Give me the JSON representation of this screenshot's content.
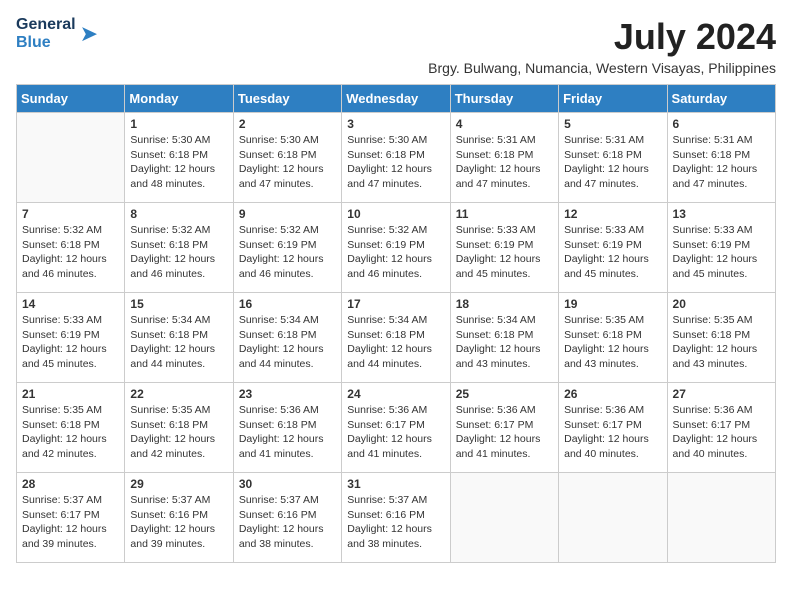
{
  "header": {
    "logo_line1": "General",
    "logo_line2": "Blue",
    "month_year": "July 2024",
    "location": "Brgy. Bulwang, Numancia, Western Visayas, Philippines"
  },
  "days_of_week": [
    "Sunday",
    "Monday",
    "Tuesday",
    "Wednesday",
    "Thursday",
    "Friday",
    "Saturday"
  ],
  "weeks": [
    [
      {
        "day": "",
        "sunrise": "",
        "sunset": "",
        "daylight": ""
      },
      {
        "day": "1",
        "sunrise": "Sunrise: 5:30 AM",
        "sunset": "Sunset: 6:18 PM",
        "daylight": "Daylight: 12 hours and 48 minutes."
      },
      {
        "day": "2",
        "sunrise": "Sunrise: 5:30 AM",
        "sunset": "Sunset: 6:18 PM",
        "daylight": "Daylight: 12 hours and 47 minutes."
      },
      {
        "day": "3",
        "sunrise": "Sunrise: 5:30 AM",
        "sunset": "Sunset: 6:18 PM",
        "daylight": "Daylight: 12 hours and 47 minutes."
      },
      {
        "day": "4",
        "sunrise": "Sunrise: 5:31 AM",
        "sunset": "Sunset: 6:18 PM",
        "daylight": "Daylight: 12 hours and 47 minutes."
      },
      {
        "day": "5",
        "sunrise": "Sunrise: 5:31 AM",
        "sunset": "Sunset: 6:18 PM",
        "daylight": "Daylight: 12 hours and 47 minutes."
      },
      {
        "day": "6",
        "sunrise": "Sunrise: 5:31 AM",
        "sunset": "Sunset: 6:18 PM",
        "daylight": "Daylight: 12 hours and 47 minutes."
      }
    ],
    [
      {
        "day": "7",
        "sunrise": "Sunrise: 5:32 AM",
        "sunset": "Sunset: 6:18 PM",
        "daylight": "Daylight: 12 hours and 46 minutes."
      },
      {
        "day": "8",
        "sunrise": "Sunrise: 5:32 AM",
        "sunset": "Sunset: 6:18 PM",
        "daylight": "Daylight: 12 hours and 46 minutes."
      },
      {
        "day": "9",
        "sunrise": "Sunrise: 5:32 AM",
        "sunset": "Sunset: 6:19 PM",
        "daylight": "Daylight: 12 hours and 46 minutes."
      },
      {
        "day": "10",
        "sunrise": "Sunrise: 5:32 AM",
        "sunset": "Sunset: 6:19 PM",
        "daylight": "Daylight: 12 hours and 46 minutes."
      },
      {
        "day": "11",
        "sunrise": "Sunrise: 5:33 AM",
        "sunset": "Sunset: 6:19 PM",
        "daylight": "Daylight: 12 hours and 45 minutes."
      },
      {
        "day": "12",
        "sunrise": "Sunrise: 5:33 AM",
        "sunset": "Sunset: 6:19 PM",
        "daylight": "Daylight: 12 hours and 45 minutes."
      },
      {
        "day": "13",
        "sunrise": "Sunrise: 5:33 AM",
        "sunset": "Sunset: 6:19 PM",
        "daylight": "Daylight: 12 hours and 45 minutes."
      }
    ],
    [
      {
        "day": "14",
        "sunrise": "Sunrise: 5:33 AM",
        "sunset": "Sunset: 6:19 PM",
        "daylight": "Daylight: 12 hours and 45 minutes."
      },
      {
        "day": "15",
        "sunrise": "Sunrise: 5:34 AM",
        "sunset": "Sunset: 6:18 PM",
        "daylight": "Daylight: 12 hours and 44 minutes."
      },
      {
        "day": "16",
        "sunrise": "Sunrise: 5:34 AM",
        "sunset": "Sunset: 6:18 PM",
        "daylight": "Daylight: 12 hours and 44 minutes."
      },
      {
        "day": "17",
        "sunrise": "Sunrise: 5:34 AM",
        "sunset": "Sunset: 6:18 PM",
        "daylight": "Daylight: 12 hours and 44 minutes."
      },
      {
        "day": "18",
        "sunrise": "Sunrise: 5:34 AM",
        "sunset": "Sunset: 6:18 PM",
        "daylight": "Daylight: 12 hours and 43 minutes."
      },
      {
        "day": "19",
        "sunrise": "Sunrise: 5:35 AM",
        "sunset": "Sunset: 6:18 PM",
        "daylight": "Daylight: 12 hours and 43 minutes."
      },
      {
        "day": "20",
        "sunrise": "Sunrise: 5:35 AM",
        "sunset": "Sunset: 6:18 PM",
        "daylight": "Daylight: 12 hours and 43 minutes."
      }
    ],
    [
      {
        "day": "21",
        "sunrise": "Sunrise: 5:35 AM",
        "sunset": "Sunset: 6:18 PM",
        "daylight": "Daylight: 12 hours and 42 minutes."
      },
      {
        "day": "22",
        "sunrise": "Sunrise: 5:35 AM",
        "sunset": "Sunset: 6:18 PM",
        "daylight": "Daylight: 12 hours and 42 minutes."
      },
      {
        "day": "23",
        "sunrise": "Sunrise: 5:36 AM",
        "sunset": "Sunset: 6:18 PM",
        "daylight": "Daylight: 12 hours and 41 minutes."
      },
      {
        "day": "24",
        "sunrise": "Sunrise: 5:36 AM",
        "sunset": "Sunset: 6:17 PM",
        "daylight": "Daylight: 12 hours and 41 minutes."
      },
      {
        "day": "25",
        "sunrise": "Sunrise: 5:36 AM",
        "sunset": "Sunset: 6:17 PM",
        "daylight": "Daylight: 12 hours and 41 minutes."
      },
      {
        "day": "26",
        "sunrise": "Sunrise: 5:36 AM",
        "sunset": "Sunset: 6:17 PM",
        "daylight": "Daylight: 12 hours and 40 minutes."
      },
      {
        "day": "27",
        "sunrise": "Sunrise: 5:36 AM",
        "sunset": "Sunset: 6:17 PM",
        "daylight": "Daylight: 12 hours and 40 minutes."
      }
    ],
    [
      {
        "day": "28",
        "sunrise": "Sunrise: 5:37 AM",
        "sunset": "Sunset: 6:17 PM",
        "daylight": "Daylight: 12 hours and 39 minutes."
      },
      {
        "day": "29",
        "sunrise": "Sunrise: 5:37 AM",
        "sunset": "Sunset: 6:16 PM",
        "daylight": "Daylight: 12 hours and 39 minutes."
      },
      {
        "day": "30",
        "sunrise": "Sunrise: 5:37 AM",
        "sunset": "Sunset: 6:16 PM",
        "daylight": "Daylight: 12 hours and 38 minutes."
      },
      {
        "day": "31",
        "sunrise": "Sunrise: 5:37 AM",
        "sunset": "Sunset: 6:16 PM",
        "daylight": "Daylight: 12 hours and 38 minutes."
      },
      {
        "day": "",
        "sunrise": "",
        "sunset": "",
        "daylight": ""
      },
      {
        "day": "",
        "sunrise": "",
        "sunset": "",
        "daylight": ""
      },
      {
        "day": "",
        "sunrise": "",
        "sunset": "",
        "daylight": ""
      }
    ]
  ]
}
